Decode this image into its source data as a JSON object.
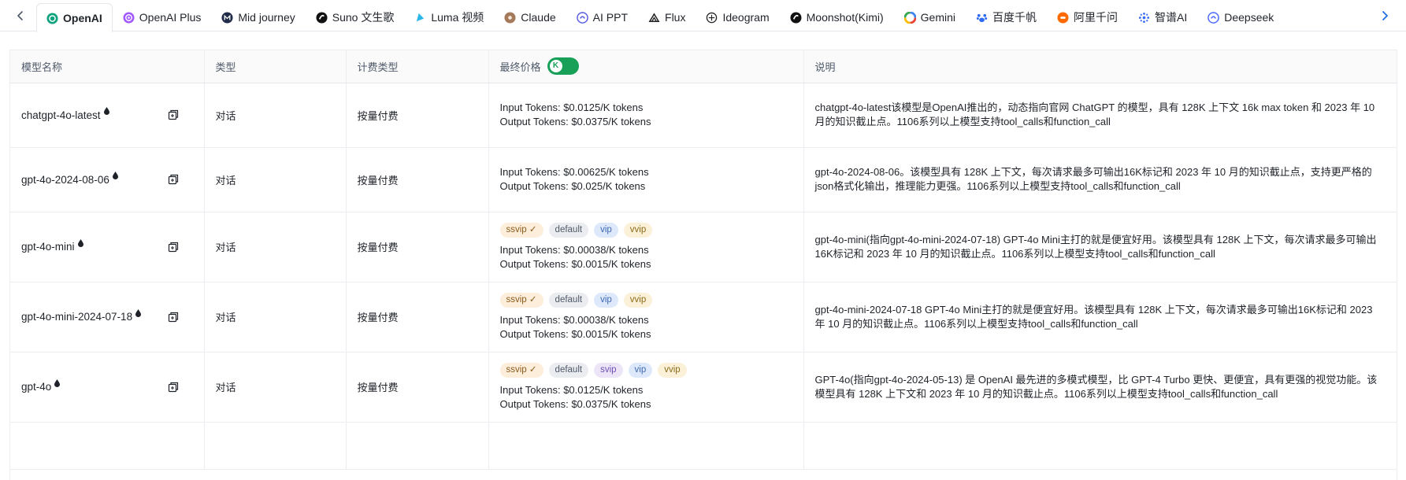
{
  "tabs": [
    {
      "label": "OpenAI",
      "icon": "openai-icon",
      "color": "#10a37f",
      "active": true
    },
    {
      "label": "OpenAI Plus",
      "icon": "openai-plus-icon",
      "color": "#a259ff",
      "active": false
    },
    {
      "label": "Mid journey",
      "icon": "midjourney-icon",
      "color": "#1f2b48",
      "active": false
    },
    {
      "label": "Suno 文生歌",
      "icon": "suno-icon",
      "color": "#111111",
      "active": false
    },
    {
      "label": "Luma 视频",
      "icon": "luma-icon",
      "color": "#2bb7e8",
      "active": false
    },
    {
      "label": "Claude",
      "icon": "claude-icon",
      "color": "#a57a5a",
      "active": false
    },
    {
      "label": "AI PPT",
      "icon": "aippt-icon",
      "color": "#5a5fe0",
      "active": false
    },
    {
      "label": "Flux",
      "icon": "flux-icon",
      "color": "#222222",
      "active": false
    },
    {
      "label": "Ideogram",
      "icon": "ideogram-icon",
      "color": "#222222",
      "active": false
    },
    {
      "label": "Moonshot(Kimi)",
      "icon": "moonshot-icon",
      "color": "#111111",
      "active": false
    },
    {
      "label": "Gemini",
      "icon": "gemini-icon",
      "color": "#4285f4",
      "active": false
    },
    {
      "label": "百度千帆",
      "icon": "baidu-icon",
      "color": "#2f6bf2",
      "active": false
    },
    {
      "label": "阿里千问",
      "icon": "ali-icon",
      "color": "#ff6a00",
      "active": false
    },
    {
      "label": "智谱AI",
      "icon": "zhipu-icon",
      "color": "#3b6ef5",
      "active": false
    },
    {
      "label": "Deepseek",
      "icon": "deepseek-icon",
      "color": "#4d6bfe",
      "active": false
    }
  ],
  "table": {
    "headers": {
      "name": "模型名称",
      "type": "类型",
      "billing": "计费类型",
      "price": "最终价格",
      "desc": "说明"
    },
    "price_toggle": {
      "label": "K",
      "on": true,
      "color": "#18a058"
    },
    "rows": [
      {
        "name": "chatgpt-4o-latest",
        "type": "对话",
        "billing": "按量付费",
        "tags": [],
        "input": "Input Tokens: $0.0125/K tokens",
        "output": "Output Tokens: $0.0375/K tokens",
        "desc": "chatgpt-4o-latest该模型是OpenAI推出的，动态指向官网 ChatGPT 的模型，具有 128K 上下文 16k max token 和 2023 年 10 月的知识截止点。1106系列以上模型支持tool_calls和function_call"
      },
      {
        "name": "gpt-4o-2024-08-06",
        "type": "对话",
        "billing": "按量付费",
        "tags": [],
        "input": "Input Tokens: $0.00625/K tokens",
        "output": "Output Tokens: $0.025/K tokens",
        "desc": "gpt-4o-2024-08-06。该模型具有 128K 上下文，每次请求最多可输出16K标记和 2023 年 10 月的知识截止点，支持更严格的json格式化输出，推理能力更强。1106系列以上模型支持tool_calls和function_call"
      },
      {
        "name": "gpt-4o-mini",
        "type": "对话",
        "billing": "按量付费",
        "tags": [
          {
            "label": "ssvip ✓",
            "kind": "ssvip"
          },
          {
            "label": "default",
            "kind": "default"
          },
          {
            "label": "vip",
            "kind": "vip"
          },
          {
            "label": "vvip",
            "kind": "vvip"
          }
        ],
        "input": "Input Tokens: $0.00038/K tokens",
        "output": "Output Tokens: $0.0015/K tokens",
        "desc": "gpt-4o-mini(指向gpt-4o-mini-2024-07-18) GPT-4o Mini主打的就是便宜好用。该模型具有 128K 上下文，每次请求最多可输出16K标记和 2023 年 10 月的知识截止点。1106系列以上模型支持tool_calls和function_call"
      },
      {
        "name": "gpt-4o-mini-2024-07-18",
        "type": "对话",
        "billing": "按量付费",
        "tags": [
          {
            "label": "ssvip ✓",
            "kind": "ssvip"
          },
          {
            "label": "default",
            "kind": "default"
          },
          {
            "label": "vip",
            "kind": "vip"
          },
          {
            "label": "vvip",
            "kind": "vvip"
          }
        ],
        "input": "Input Tokens: $0.00038/K tokens",
        "output": "Output Tokens: $0.0015/K tokens",
        "desc": "gpt-4o-mini-2024-07-18 GPT-4o Mini主打的就是便宜好用。该模型具有 128K 上下文，每次请求最多可输出16K标记和 2023 年 10 月的知识截止点。1106系列以上模型支持tool_calls和function_call"
      },
      {
        "name": "gpt-4o",
        "type": "对话",
        "billing": "按量付费",
        "tags": [
          {
            "label": "ssvip ✓",
            "kind": "ssvip"
          },
          {
            "label": "default",
            "kind": "default"
          },
          {
            "label": "svip",
            "kind": "svip"
          },
          {
            "label": "vip",
            "kind": "vip"
          },
          {
            "label": "vvip",
            "kind": "vvip"
          }
        ],
        "input": "Input Tokens: $0.0125/K tokens",
        "output": "Output Tokens: $0.0375/K tokens",
        "desc": "GPT-4o(指向gpt-4o-2024-05-13) 是 OpenAI 最先进的多模式模型，比 GPT-4 Turbo 更快、更便宜，具有更强的视觉功能。该模型具有 128K 上下文和 2023 年 10 月的知识截止点。1106系列以上模型支持tool_calls和function_call"
      }
    ]
  }
}
